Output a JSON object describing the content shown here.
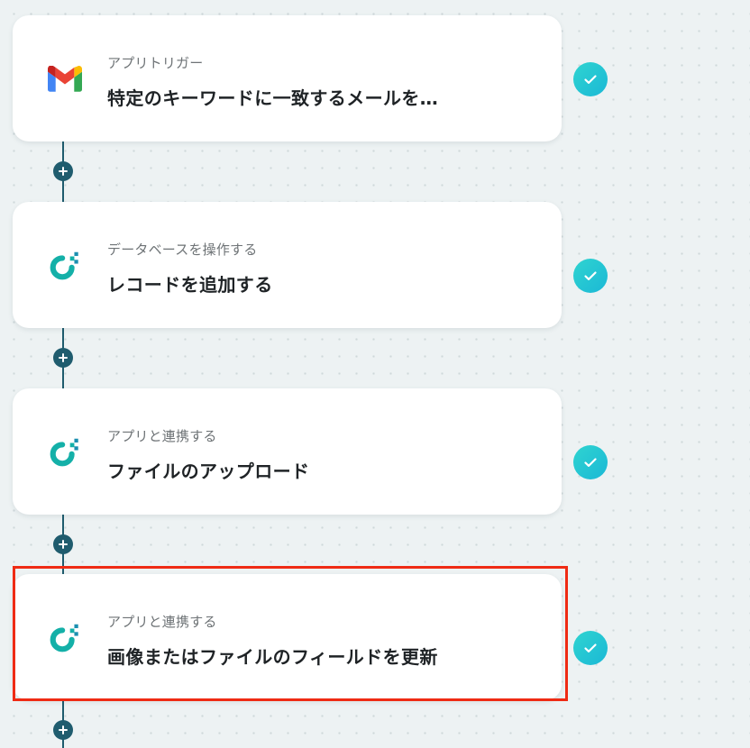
{
  "steps": [
    {
      "app": "gmail",
      "logo_icon": "gmail-icon",
      "subtitle": "アプリトリガー",
      "title": "特定のキーワードに一致するメールを…",
      "status": "completed"
    },
    {
      "app": "yoom",
      "logo_icon": "yoom-icon",
      "subtitle": "データベースを操作する",
      "title": "レコードを追加する",
      "status": "completed"
    },
    {
      "app": "yoom",
      "logo_icon": "yoom-icon",
      "subtitle": "アプリと連携する",
      "title": "ファイルのアップロード",
      "status": "completed"
    },
    {
      "app": "yoom",
      "logo_icon": "yoom-icon",
      "subtitle": "アプリと連携する",
      "title": "画像またはファイルのフィールドを更新",
      "status": "completed"
    }
  ],
  "colors": {
    "connector": "#1f5c6e",
    "check_gradient_start": "#2fd4d0",
    "check_gradient_end": "#1bb8d6",
    "highlight": "#ef2b14",
    "background": "#edf2f3"
  },
  "highlighted_step": 4
}
